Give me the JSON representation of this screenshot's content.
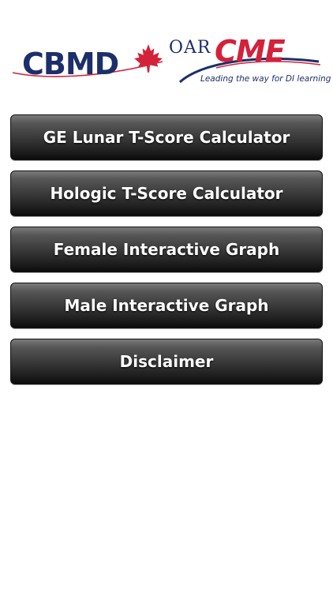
{
  "logos": {
    "cbmd": {
      "text": "CBMD",
      "color": "#1c2f6b",
      "accent": "#d4213a",
      "icon": "maple-leaf-icon"
    },
    "oarcme": {
      "prefix": "OAR",
      "brand": "CME",
      "tagline": "Leading the way for DI learning",
      "color": "#1c2f6b",
      "accent": "#d4213a"
    }
  },
  "menu": {
    "items": [
      {
        "label": "GE Lunar T-Score Calculator"
      },
      {
        "label": "Hologic T-Score Calculator"
      },
      {
        "label": "Female Interactive Graph"
      },
      {
        "label": "Male Interactive Graph"
      },
      {
        "label": "Disclaimer"
      }
    ]
  }
}
